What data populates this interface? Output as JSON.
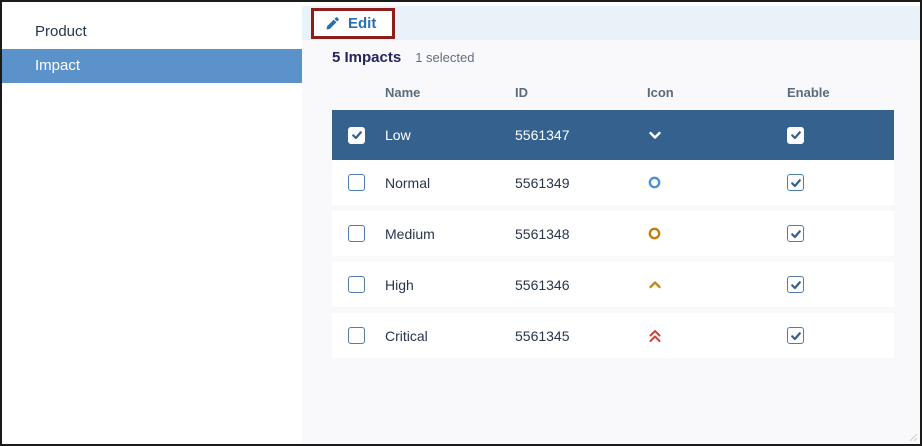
{
  "sidebar": {
    "items": [
      {
        "label": "Product",
        "selected": false
      },
      {
        "label": "Impact",
        "selected": true
      }
    ]
  },
  "toolbar": {
    "edit_label": "Edit"
  },
  "header": {
    "title": "5 Impacts",
    "selection_status": "1 selected"
  },
  "table": {
    "columns": [
      "Name",
      "ID",
      "Icon",
      "Enable"
    ],
    "rows": [
      {
        "name": "Low",
        "id": "5561347",
        "icon": "chevron-down-icon",
        "icon_color": "#ffffff",
        "selected": true,
        "row_checkbox_checked": true,
        "enabled": true
      },
      {
        "name": "Normal",
        "id": "5561349",
        "icon": "circle-icon",
        "icon_color": "#4a90d9",
        "selected": false,
        "row_checkbox_checked": false,
        "enabled": true
      },
      {
        "name": "Medium",
        "id": "5561348",
        "icon": "circle-icon",
        "icon_color": "#bf7e10",
        "selected": false,
        "row_checkbox_checked": false,
        "enabled": true
      },
      {
        "name": "High",
        "id": "5561346",
        "icon": "chevron-up-icon",
        "icon_color": "#c4891c",
        "selected": false,
        "row_checkbox_checked": false,
        "enabled": true
      },
      {
        "name": "Critical",
        "id": "5561345",
        "icon": "double-chevron-up-icon",
        "icon_color": "#d43f3f",
        "selected": false,
        "row_checkbox_checked": false,
        "enabled": true
      }
    ]
  },
  "colors": {
    "sidebar_selected_bg": "#5b92c9",
    "selected_row_bg": "#35618e",
    "toolbar_bg": "#e9f1f9",
    "edit_blue": "#2a6fb5",
    "annotation_red": "#8e1d1d",
    "checkbox_check": "#35618f",
    "page_bg": "#f9f9fb"
  }
}
